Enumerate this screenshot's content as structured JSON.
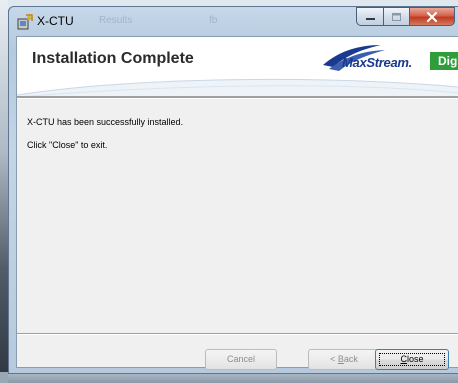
{
  "window": {
    "title": "X-CTU",
    "ghost_titles": [
      "Results",
      "fb"
    ],
    "icons": {
      "app": "xctu-app-icon",
      "minimize": "minimize-icon",
      "maximize": "maximize-icon",
      "close": "close-x-icon"
    }
  },
  "banner": {
    "heading": "Installation Complete",
    "logo_maxstream": "MaxStream.",
    "logo_digi": "Digi"
  },
  "content": {
    "line1": "X-CTU has been successfully installed.",
    "line2": "Click \"Close\" to exit."
  },
  "buttons": {
    "cancel": "Cancel",
    "back_prefix": "< ",
    "back_mnemonic": "B",
    "back_rest": "ack",
    "close_mnemonic": "C",
    "close_rest": "lose"
  },
  "colors": {
    "close_button": "#c03b22",
    "logo_blue": "#1a3a8f",
    "digi_green": "#2e9e3a",
    "focus_border": "#3c7fb1"
  }
}
